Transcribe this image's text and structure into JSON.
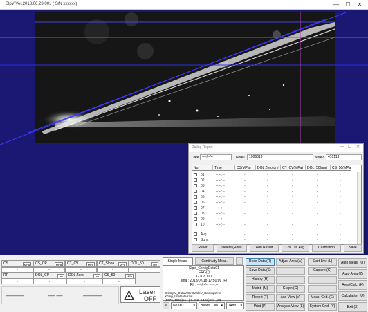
{
  "window": {
    "title": "SlpV Ver.2018.06.23.001  ( S/N xxxxxx)",
    "minimize": "—",
    "maximize": "☐",
    "close": "✕"
  },
  "dialog": {
    "title": "Dialog Report",
    "date_label": "Date",
    "date_value": "----/--/--",
    "note1_label": "Note1",
    "note1_value": "1906013",
    "note2_label": "Note2",
    "note2_value": "410113",
    "columns": [
      "No.",
      "Time",
      "CS(MPa)",
      "DOL Zero(μm)",
      "CT_CV(MPa)",
      "DOL_50(μm)",
      "CS_50(MPa)"
    ],
    "rows": [
      {
        "no": "01",
        "time": "--:--:--",
        "v": [
          "-",
          "-",
          "-",
          "-",
          "-"
        ]
      },
      {
        "no": "02",
        "time": "--:--:--",
        "v": [
          "-",
          "-",
          "-",
          "-",
          "-"
        ]
      },
      {
        "no": "03",
        "time": "--:--:--",
        "v": [
          "-",
          "-",
          "-",
          "-",
          "-"
        ]
      },
      {
        "no": "04",
        "time": "--:--:--",
        "v": [
          "-",
          "-",
          "-",
          "-",
          "-"
        ]
      },
      {
        "no": "05",
        "time": "--:--:--",
        "v": [
          "-",
          "-",
          "-",
          "-",
          "-"
        ]
      },
      {
        "no": "06",
        "time": "--:--:--",
        "v": [
          "-",
          "-",
          "-",
          "-",
          "-"
        ]
      },
      {
        "no": "07",
        "time": "--:--:--",
        "v": [
          "-",
          "-",
          "-",
          "-",
          "-"
        ]
      },
      {
        "no": "08",
        "time": "--:--:--",
        "v": [
          "-",
          "-",
          "-",
          "-",
          "-"
        ]
      },
      {
        "no": "09",
        "time": "--:--:--",
        "v": [
          "-",
          "-",
          "-",
          "-",
          "-"
        ]
      },
      {
        "no": "10",
        "time": "--:--:--",
        "v": [
          "-",
          "-",
          "-",
          "-",
          "-"
        ]
      }
    ],
    "summary_rows": [
      {
        "label": "Avg.",
        "v": [
          "-",
          "-",
          "-",
          "-",
          "-"
        ]
      },
      {
        "label": "Sgm.",
        "v": [
          "-",
          "-",
          "-",
          "-",
          "-"
        ]
      },
      {
        "label": "Dis.Avg.",
        "v": [
          "-",
          "-",
          "-",
          "-",
          "-"
        ]
      }
    ],
    "buttons": [
      "Reset",
      "Delete (Row)",
      "Add Result",
      "Col. Dis.Avg.",
      "Calibration",
      "Save"
    ]
  },
  "results": {
    "row1": [
      {
        "label": "CS",
        "unit": "MPa"
      },
      {
        "label": "CS_CP",
        "unit": "MPa"
      },
      {
        "label": "CT_CV",
        "unit": "MPa"
      },
      {
        "label": "CT_Slope",
        "unit": "MPa"
      },
      {
        "label": "DOL_50",
        "unit": "μm"
      }
    ],
    "row1_values": [
      "-",
      "-",
      "-",
      "-",
      "-"
    ],
    "row2": [
      {
        "label": "RR",
        "unit": ""
      },
      {
        "label": "DOL_CP",
        "unit": "μm"
      },
      {
        "label": "DOL Zero",
        "unit": "μm"
      },
      {
        "label": "CS_50",
        "unit": "MPa"
      }
    ],
    "row2_values": [
      "-",
      "-",
      "-",
      "-"
    ],
    "big_values": [
      "———",
      "— —",
      "———"
    ]
  },
  "laser": {
    "line1": "Laser",
    "line2": "OFF"
  },
  "mode": {
    "single_tab": "Single Meas.",
    "continuity_tab": "Continuity Meas.",
    "info_lines": [
      "SlpV_ConfigData01",
      "ERG(r)",
      "G = 2.100",
      "",
      "Ima :  2018/07/18 17:50:09 (F)",
      "Rlt :  ----/--/-- --:--:--"
    ],
    "path_lines": [
      "C:¥SlpV_Data¥¥ErG¥SlpV_Backup¥Inc",
      "¥Tmp_ImaData.raw",
      "(1676, 1560)px , ( 6.472, 0.153)mm ,  33"
    ],
    "bottom_controls": {
      "left_btn": "<",
      "no_select": "No.001",
      "beam_select": "Beam. Cen",
      "bit_select": "14bit"
    }
  },
  "sidebar_buttons": {
    "col1": [
      "Read Data (R)",
      "Save Data (S)",
      "History (H)",
      "Maint. (M)",
      "Report (T)",
      "Print (P)"
    ],
    "col2": [
      "Adjust Area (A)",
      "- -",
      "- -",
      "Graph (G)",
      "Aux View (V)",
      "Analysis View (L)"
    ],
    "col3": [
      "Start Live (L)",
      "Capture (C)",
      "- -",
      "- -",
      "Meas. Cnd. (E)",
      "System Cnd. (Y)"
    ],
    "col4": [
      "Auto Meas. (O)",
      "Auto Area (Z)",
      "Area/Calc. (K)",
      "Calculation (U)",
      "Exit (X)"
    ]
  },
  "colors": {
    "viewer_bg": "#1a1872",
    "magenta_line": "#b040c0",
    "blue_line": "#3030e0"
  }
}
